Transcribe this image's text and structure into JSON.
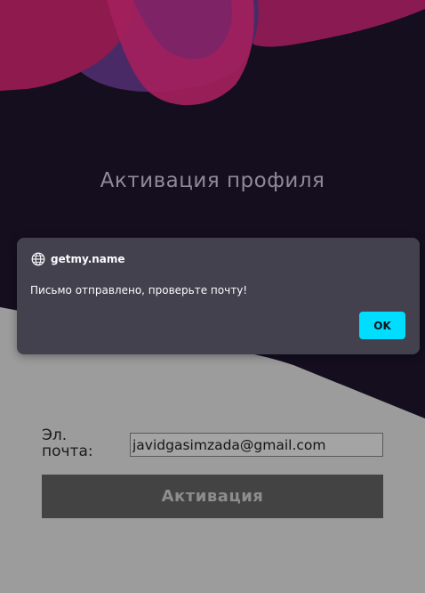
{
  "page": {
    "title": "Активация профиля"
  },
  "form": {
    "email_label": "Эл. почта:",
    "email_value": "javidgasimzada@gmail.com",
    "submit_label": "Активация"
  },
  "dialog": {
    "origin": "getmy.name",
    "message": "Письмо отправлено, проверьте почту!",
    "ok_label": "OK"
  },
  "colors": {
    "dark_background": "#140e1f",
    "form_background": "#9c9c9c",
    "dialog_background": "#42414d",
    "ok_button": "#00ddff",
    "blob_magenta": "#9b1a57",
    "blob_purple": "#6b2a6e"
  },
  "icons": {
    "dialog_origin_icon": "globe-icon"
  }
}
